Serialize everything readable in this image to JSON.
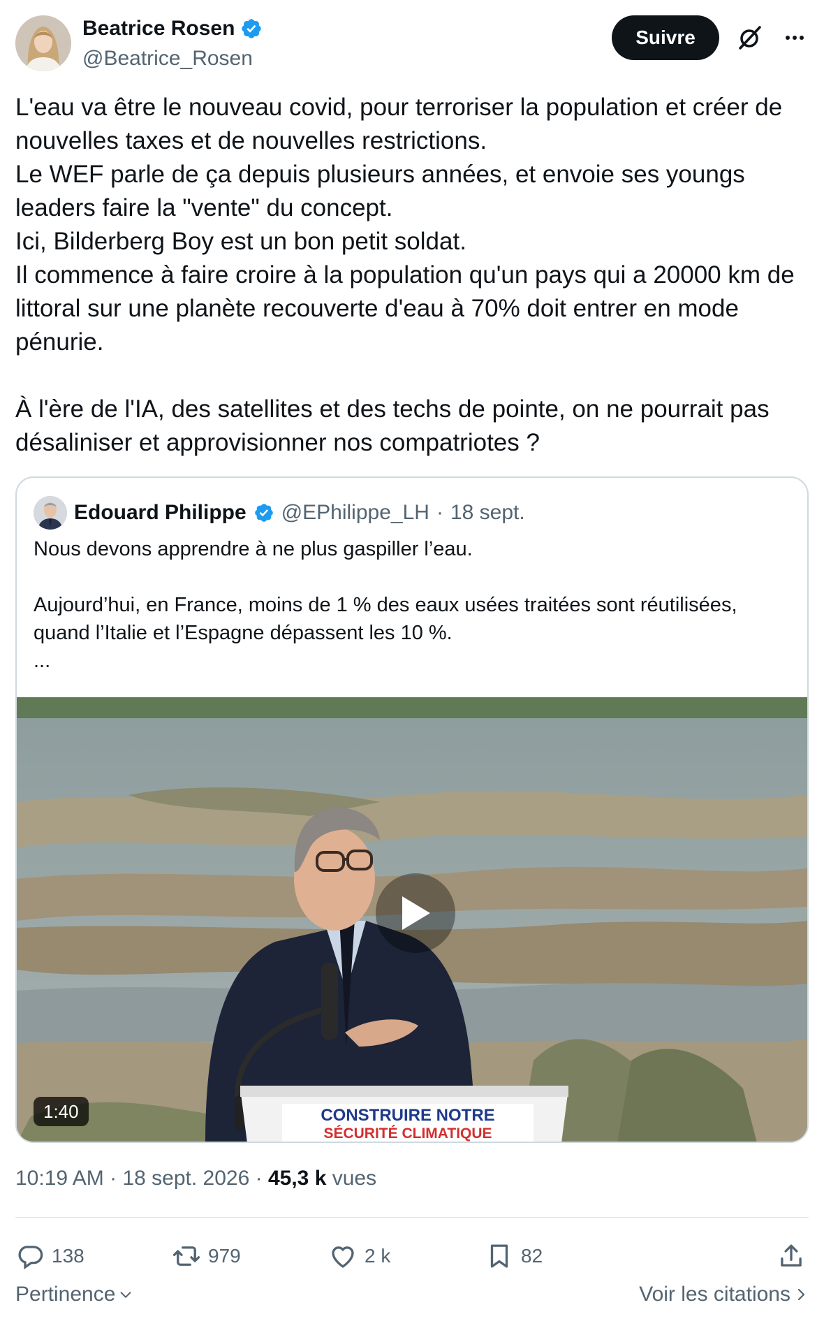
{
  "author": {
    "name": "Beatrice Rosen",
    "handle": "@Beatrice_Rosen",
    "verified": true,
    "follow_label": "Suivre"
  },
  "icons": {
    "verified": "verified-badge-icon",
    "grok": "grok-icon",
    "more": "more-icon",
    "reply": "reply-icon",
    "repost": "repost-icon",
    "like": "like-icon",
    "bookmark": "bookmark-icon",
    "share": "share-icon",
    "play": "play-icon",
    "chevron_down": "chevron-down-icon",
    "chevron_right": "chevron-right-icon"
  },
  "colors": {
    "verified": "#1d9bf0",
    "text": "#0f1419",
    "muted": "#536471",
    "border": "#cfd9de"
  },
  "post": {
    "lines": [
      "L'eau va être le nouveau covid, pour terroriser la population et créer de nouvelles taxes et de nouvelles restrictions.",
      "Le WEF parle de ça depuis plusieurs années, et envoie ses youngs leaders faire la \"vente\" du concept.",
      "Ici, Bilderberg Boy est un bon petit soldat.",
      "Il commence à faire croire à la population qu'un pays qui a 20000 km de littoral sur une planète recouverte d'eau à 70% doit entrer en mode pénurie.",
      "",
      "À l'ère de l'IA, des satellites et des techs de pointe, on ne pourrait pas désaliniser et approvisionner nos compatriotes ?"
    ]
  },
  "quote": {
    "name": "Edouard Philippe",
    "handle": "@EPhilippe_LH",
    "separator": "·",
    "date": "18 sept.",
    "lines": [
      "Nous devons apprendre à ne plus gaspiller l’eau.",
      "",
      "Aujourd’hui, en France, moins de 1 % des eaux usées traitées sont réutilisées, quand l’Italie et l’Espagne dépassent les 10 %.",
      "..."
    ],
    "video": {
      "duration": "1:40",
      "podium_line1": "CONSTRUIRE NOTRE",
      "podium_line2": "SÉCURITÉ CLIMATIQUE"
    }
  },
  "meta": {
    "time": "10:19 AM",
    "sep1": "·",
    "date": "18 sept. 2026",
    "sep2": "·",
    "views_count": "45,3 k",
    "views_label": "vues"
  },
  "actions": {
    "replies": "138",
    "reposts": "979",
    "likes": "2 k",
    "bookmarks": "82"
  },
  "footer": {
    "sort_label": "Pertinence",
    "quotes_label": "Voir les citations"
  }
}
